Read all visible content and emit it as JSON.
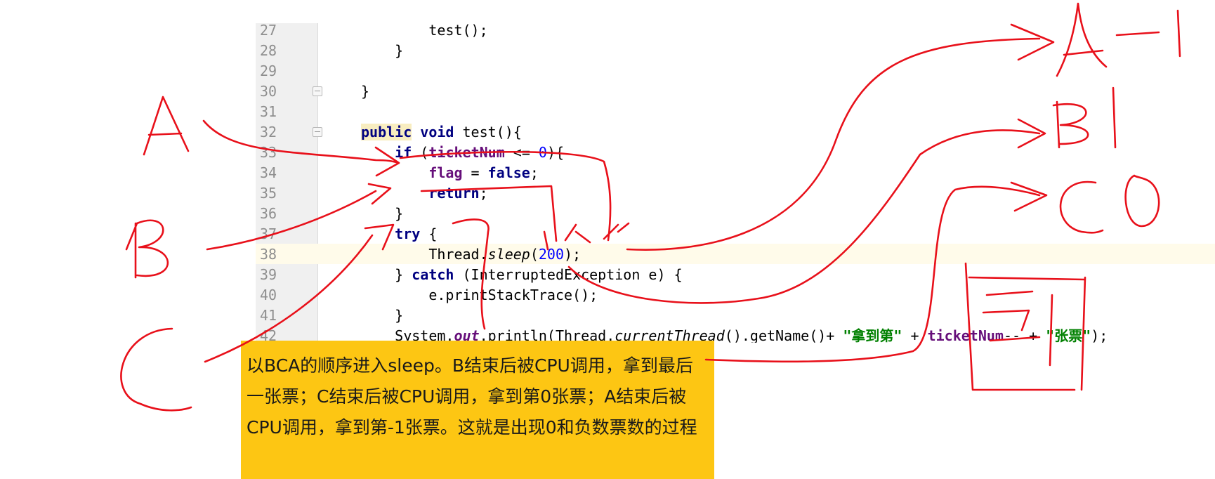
{
  "editor": {
    "lines": [
      {
        "num": "27",
        "segments": [
          {
            "t": "        test();",
            "c": ""
          }
        ]
      },
      {
        "num": "28",
        "segments": [
          {
            "t": "    }",
            "c": ""
          }
        ]
      },
      {
        "num": "29",
        "segments": [
          {
            "t": "",
            "c": ""
          }
        ]
      },
      {
        "num": "30",
        "segments": [
          {
            "t": "}",
            "c": ""
          }
        ]
      },
      {
        "num": "31",
        "segments": [
          {
            "t": "",
            "c": ""
          }
        ]
      },
      {
        "num": "32",
        "segments": [
          {
            "t": "public",
            "c": "kw-hl"
          },
          {
            "t": " ",
            "c": ""
          },
          {
            "t": "void",
            "c": "kw"
          },
          {
            "t": " test(){",
            "c": ""
          }
        ]
      },
      {
        "num": "33",
        "segments": [
          {
            "t": "    ",
            "c": ""
          },
          {
            "t": "if",
            "c": "kw"
          },
          {
            "t": " (",
            "c": ""
          },
          {
            "t": "ticketNum",
            "c": "field"
          },
          {
            "t": " <= ",
            "c": ""
          },
          {
            "t": "0",
            "c": "num"
          },
          {
            "t": "){",
            "c": ""
          }
        ]
      },
      {
        "num": "34",
        "segments": [
          {
            "t": "        ",
            "c": ""
          },
          {
            "t": "flag",
            "c": "field"
          },
          {
            "t": " = ",
            "c": ""
          },
          {
            "t": "false",
            "c": "kw"
          },
          {
            "t": ";",
            "c": ""
          }
        ]
      },
      {
        "num": "35",
        "segments": [
          {
            "t": "        ",
            "c": ""
          },
          {
            "t": "return",
            "c": "kw"
          },
          {
            "t": ";",
            "c": ""
          }
        ]
      },
      {
        "num": "36",
        "segments": [
          {
            "t": "    }",
            "c": ""
          }
        ]
      },
      {
        "num": "37",
        "segments": [
          {
            "t": "    ",
            "c": ""
          },
          {
            "t": "try",
            "c": "kw"
          },
          {
            "t": " {",
            "c": ""
          }
        ]
      },
      {
        "num": "38",
        "segments": [
          {
            "t": "        Thread.",
            "c": ""
          },
          {
            "t": "sleep",
            "c": "italic"
          },
          {
            "t": "(",
            "c": ""
          },
          {
            "t": "200",
            "c": "num"
          },
          {
            "t": ");",
            "c": ""
          }
        ]
      },
      {
        "num": "39",
        "segments": [
          {
            "t": "    } ",
            "c": ""
          },
          {
            "t": "catch",
            "c": "kw"
          },
          {
            "t": " (InterruptedException e) {",
            "c": ""
          }
        ]
      },
      {
        "num": "40",
        "segments": [
          {
            "t": "        e.printStackTrace();",
            "c": ""
          }
        ]
      },
      {
        "num": "41",
        "segments": [
          {
            "t": "    }",
            "c": ""
          }
        ]
      },
      {
        "num": "42",
        "segments": [
          {
            "t": "    System.",
            "c": ""
          },
          {
            "t": "out",
            "c": "static"
          },
          {
            "t": ".println(Thread.",
            "c": ""
          },
          {
            "t": "currentThread",
            "c": "italic"
          },
          {
            "t": "().getName()+ ",
            "c": ""
          },
          {
            "t": "\"拿到第\"",
            "c": "str"
          },
          {
            "t": " + ",
            "c": ""
          },
          {
            "t": "ticketNum",
            "c": "field"
          },
          {
            "t": "-- + ",
            "c": ""
          },
          {
            "t": "\"张票\"",
            "c": "str"
          },
          {
            "t": ");",
            "c": ""
          }
        ]
      }
    ],
    "fold_lines": [
      "30",
      "32"
    ],
    "current_line": "38"
  },
  "note": {
    "text": "以BCA的顺序进入sleep。B结束后被CPU调用，拿到最后一张票；C结束后被CPU调用，拿到第0张票；A结束后被CPU调用，拿到第-1张票。这就是出现0和负数票数的过程"
  },
  "colors": {
    "keyword": "#000080",
    "field": "#660e7a",
    "number": "#0000ff",
    "string": "#008000",
    "note_bg": "#fdc613",
    "ink": "#e8101a"
  }
}
